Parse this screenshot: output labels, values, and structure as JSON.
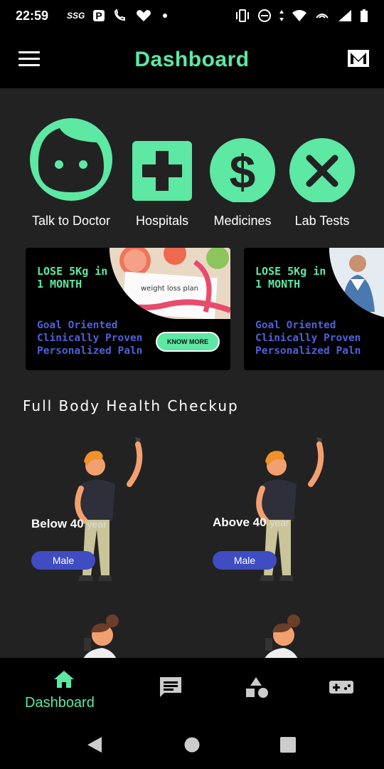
{
  "status_bar": {
    "time": "22:59",
    "carrier_tag": "SSG",
    "parking_glyph": "P"
  },
  "app_bar": {
    "title": "Dashboard"
  },
  "quick_actions": [
    {
      "label": "Talk to Doctor",
      "icon": "doctor-face-icon"
    },
    {
      "label": "Hospitals",
      "icon": "hospital-cross-icon"
    },
    {
      "label": "Medicines",
      "icon": "dollar-icon"
    },
    {
      "label": "Lab Tests",
      "icon": "close-x-icon"
    }
  ],
  "promos": [
    {
      "headline": "LOSE 5Kg in 1 MONTH",
      "subtitle": "Goal Oriented Clinically Proven Personalized Paln",
      "button": "KNOW MORE",
      "image_caption": "weight loss plan"
    },
    {
      "headline": "LOSE 5Kg in 1 MONTH",
      "subtitle": "Goal Oriented Clinically Proven Personalized Paln"
    }
  ],
  "checkup": {
    "section_title": "Full Body Health Checkup",
    "cards": [
      {
        "age_label": "Below 40",
        "year_label": "year",
        "gender": "Male"
      },
      {
        "age_label": "Above 40",
        "year_label": "year",
        "gender": "Male"
      }
    ]
  },
  "bottom_nav": [
    {
      "label": "Dashboard",
      "icon": "home-icon",
      "active": true
    },
    {
      "label": "",
      "icon": "chat-icon",
      "active": false
    },
    {
      "label": "",
      "icon": "shapes-icon",
      "active": false
    },
    {
      "label": "",
      "icon": "gamepad-icon",
      "active": false
    }
  ],
  "colors": {
    "accent": "#5de8a3",
    "promo_text": "#5060d8",
    "background": "#222222",
    "pill": "#3f4cc2"
  }
}
